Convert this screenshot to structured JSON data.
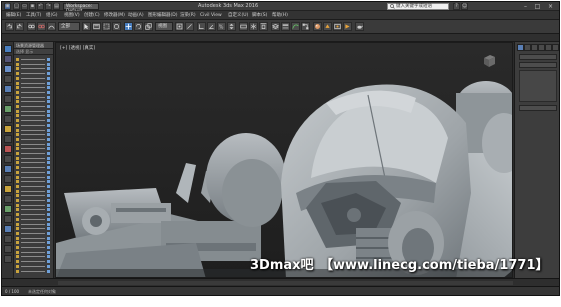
{
  "window": {
    "title": "Autodesk 3ds Max 2016",
    "workspace": "Workspace: Default",
    "search_placeholder": "键入关键字或短语",
    "quick_access_icons": [
      "new-icon",
      "open-icon",
      "save-icon",
      "undo-icon",
      "redo-icon",
      "project-icon"
    ]
  },
  "menu": {
    "items": [
      "编辑(E)",
      "工具(T)",
      "组(G)",
      "视图(V)",
      "创建(C)",
      "修改器(M)",
      "动画(A)",
      "图形编辑器(D)",
      "渲染(R)",
      "Civil View",
      "自定义(U)",
      "脚本(S)",
      "帮助(H)"
    ]
  },
  "toolbar": {
    "selection_filter": "全部",
    "view_combo": "视图"
  },
  "explorer": {
    "title": "场景资源管理器",
    "tabs": "选择 显示",
    "rows": 46
  },
  "viewport": {
    "label": "[+] [透视] [真实]"
  },
  "command_panel": {
    "tabs": [
      "create-tab",
      "modify-tab",
      "hierarchy-tab",
      "motion-tab",
      "display-tab",
      "utilities-tab"
    ]
  },
  "statusbar": {
    "frame_counter": "0 / 100",
    "text": "未选定任何对象"
  },
  "watermark": {
    "left": "3Dmax吧",
    "right": "【www.linecg.com/tieba/1771】"
  },
  "colors": {
    "ui_dark": "#2b2b2b",
    "viewport_bg": "#232323",
    "model_grey": "#9aa0a4",
    "accent_blue": "#4a7fc0"
  }
}
